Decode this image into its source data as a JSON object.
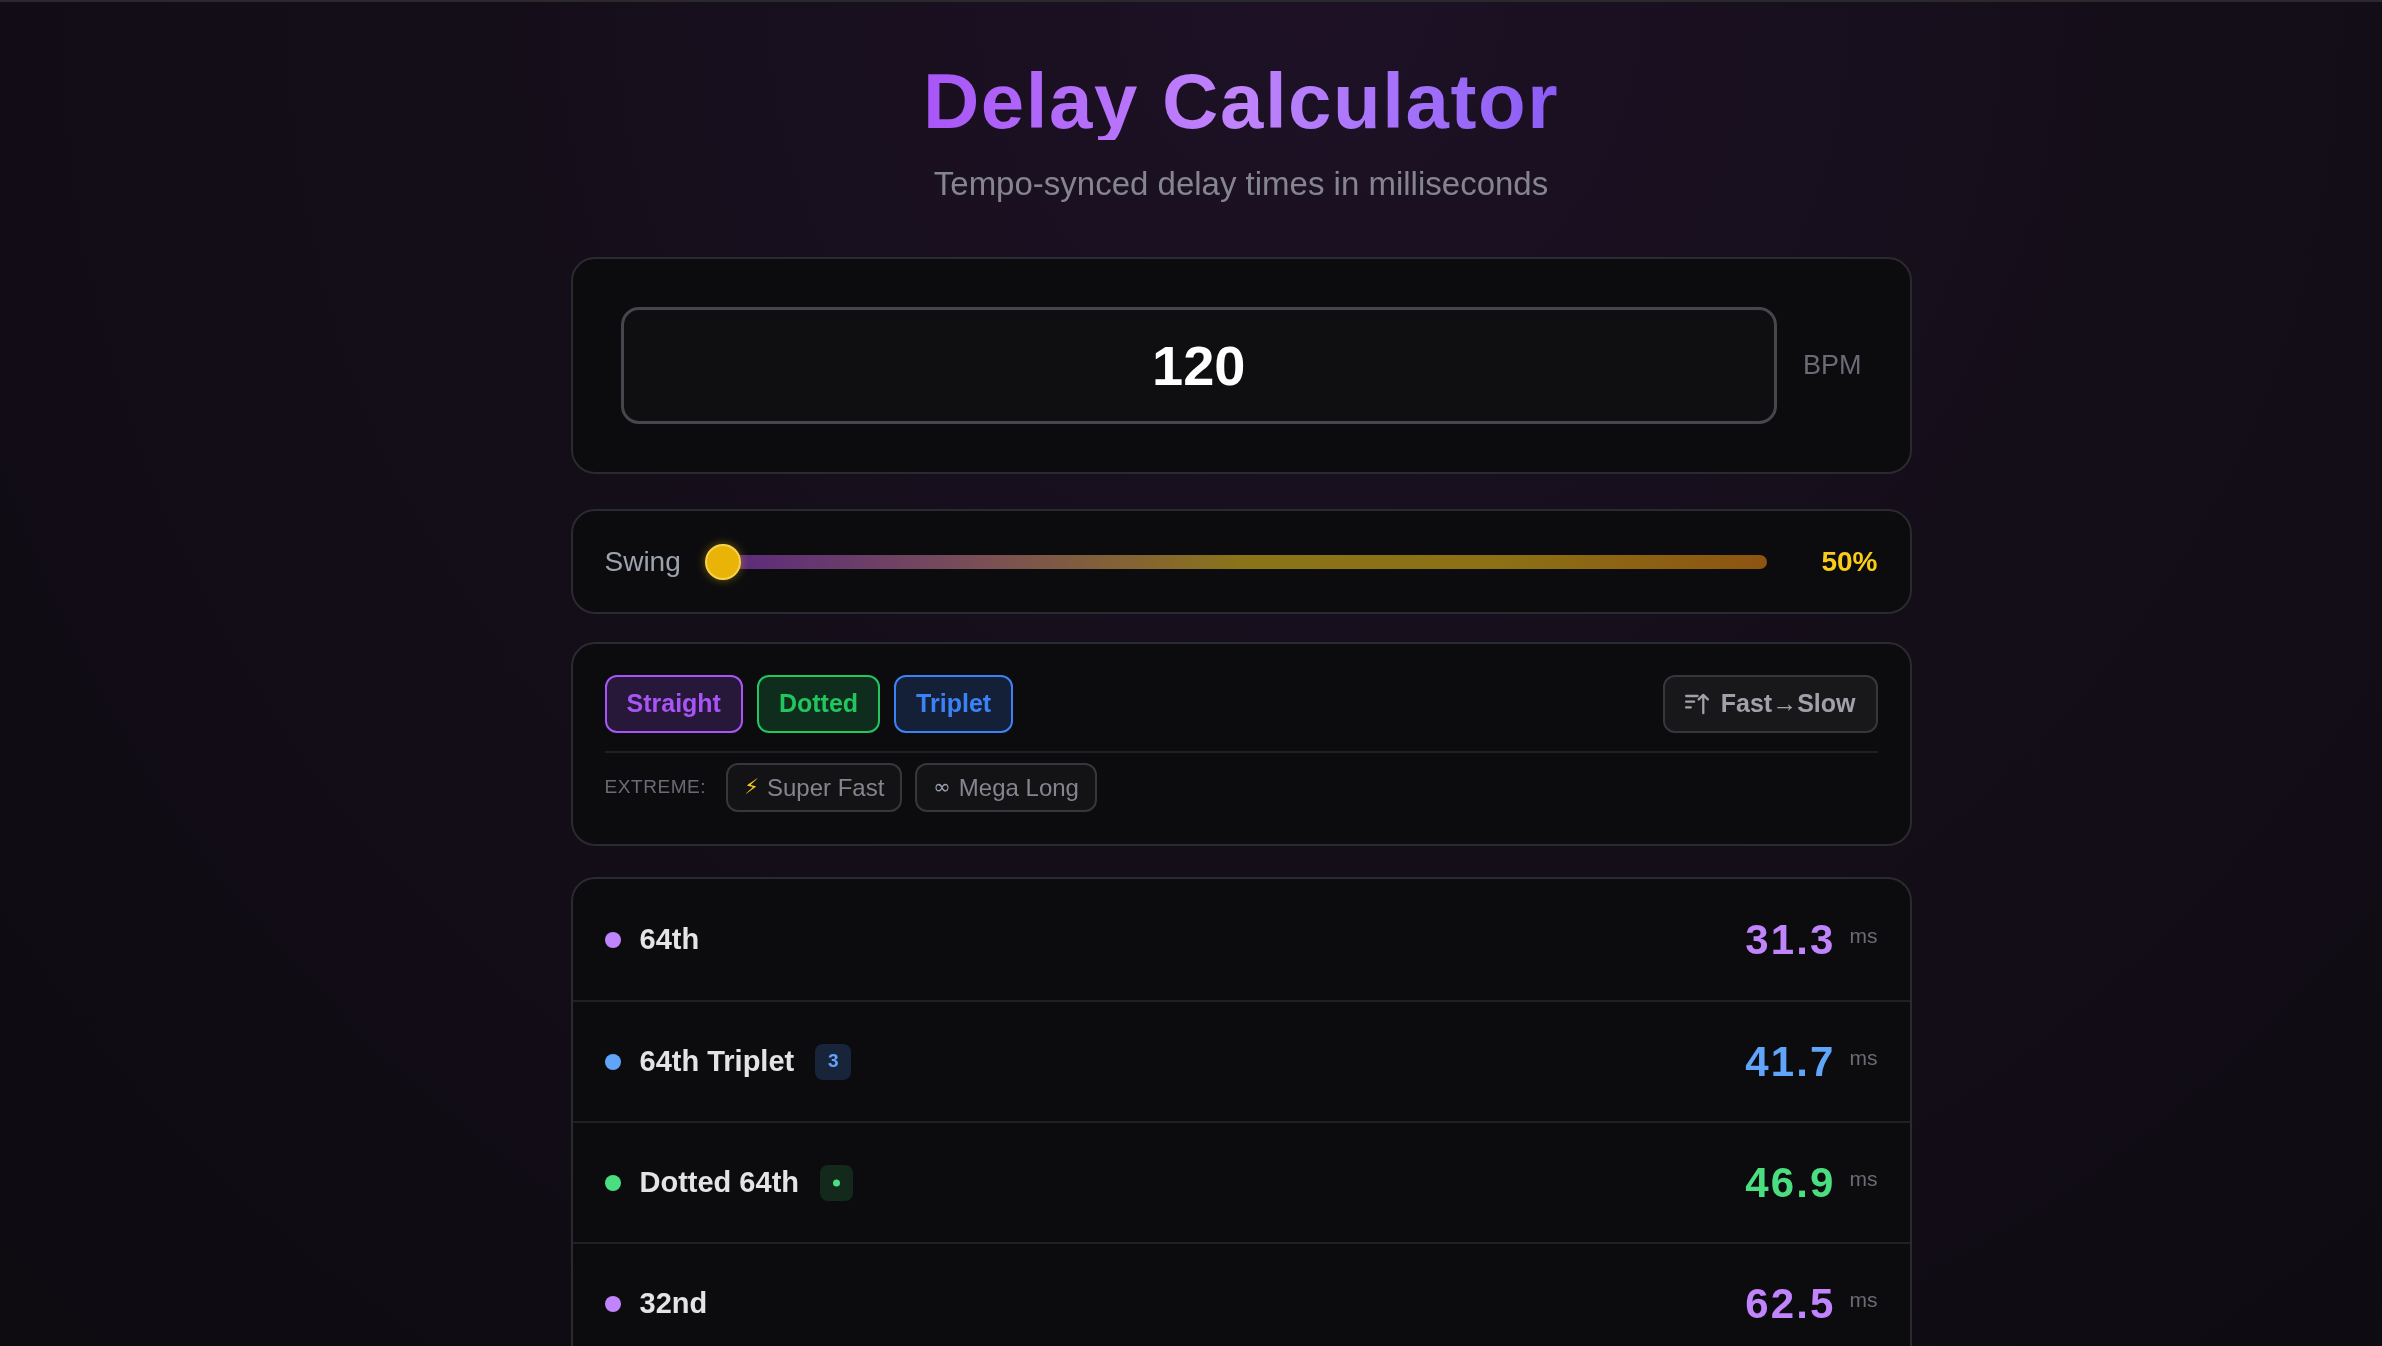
{
  "header": {
    "title": "Delay Calculator",
    "subtitle": "Tempo-synced delay times in milliseconds"
  },
  "tempo": {
    "value": "120",
    "unit": "BPM"
  },
  "swing": {
    "label": "Swing",
    "level": 0,
    "reading": "50%"
  },
  "filters": [
    {
      "label": "Straight",
      "selected": true,
      "color": "#a855f7"
    },
    {
      "label": "Dotted",
      "selected": true,
      "color": "#22c55e"
    },
    {
      "label": "Triplet",
      "selected": true,
      "color": "#3b82f6"
    }
  ],
  "sort": {
    "label": "Fast→Slow"
  },
  "extreme": {
    "label": "EXTREME:",
    "options": [
      {
        "icon": "⚡",
        "label": "Super Fast",
        "selected": false,
        "color": "#facc15"
      },
      {
        "icon": "∞",
        "label": "Mega Long",
        "selected": false,
        "color": "#9ca3af"
      }
    ]
  },
  "delays": [
    {
      "name": "64th",
      "kind": "straight",
      "color": "#c084fc",
      "value": "31.3",
      "unit": "ms"
    },
    {
      "name": "64th Triplet",
      "kind": "triplet",
      "badge": "3",
      "color": "#60a5fa",
      "value": "41.7",
      "unit": "ms"
    },
    {
      "name": "Dotted 64th",
      "kind": "dotted",
      "color": "#4ade80",
      "value": "46.9",
      "unit": "ms"
    },
    {
      "name": "32nd",
      "kind": "straight",
      "color": "#c084fc",
      "value": "62.5",
      "unit": "ms"
    }
  ]
}
